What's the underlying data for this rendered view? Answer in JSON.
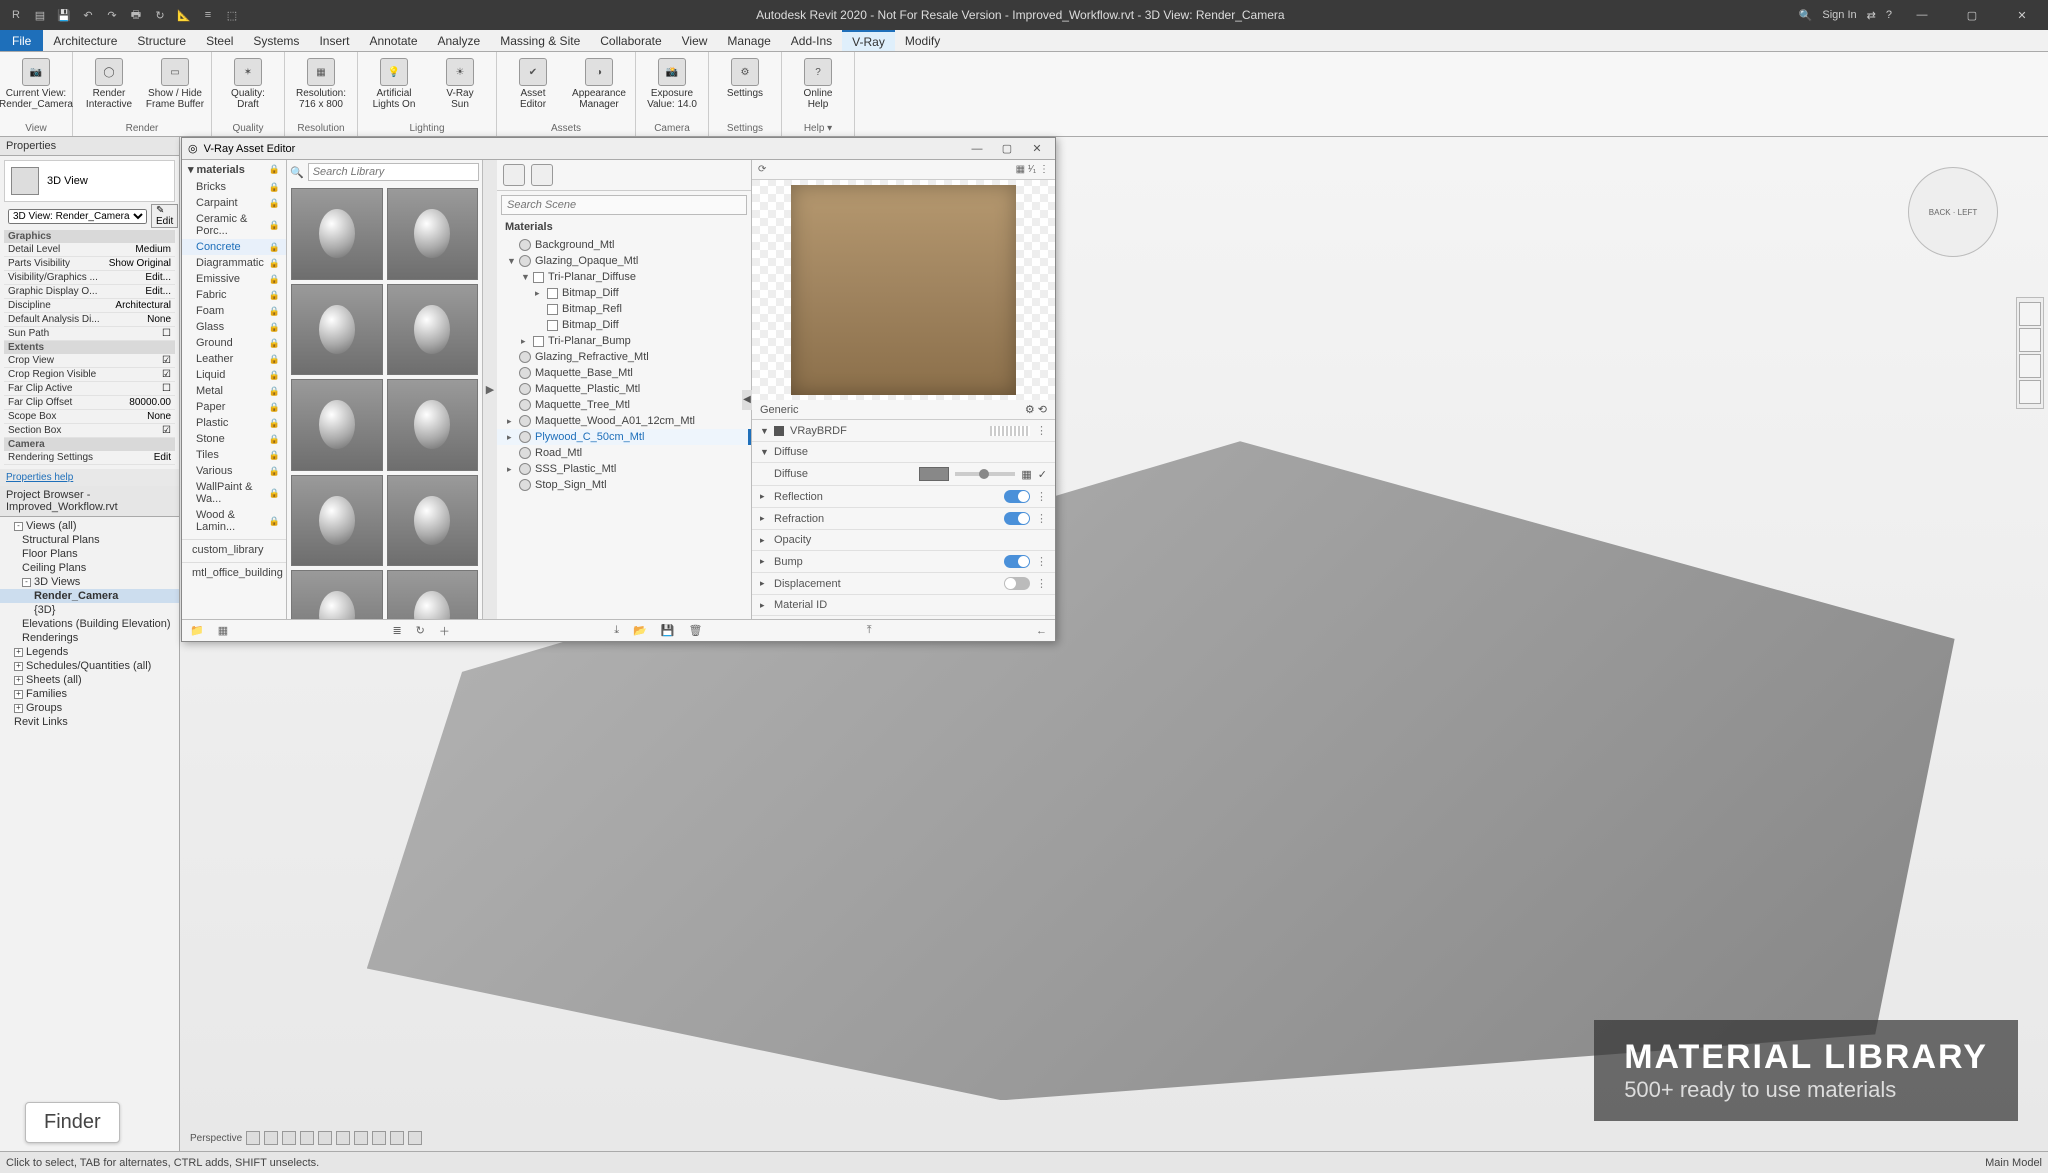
{
  "titlebar": {
    "title": "Autodesk Revit 2020 - Not For Resale Version - Improved_Workflow.rvt - 3D View: Render_Camera",
    "signin": "Sign In"
  },
  "menutabs": [
    "Architecture",
    "Structure",
    "Steel",
    "Systems",
    "Insert",
    "Annotate",
    "Analyze",
    "Massing & Site",
    "Collaborate",
    "View",
    "Manage",
    "Add-Ins",
    "V-Ray",
    "Modify"
  ],
  "active_tab": "V-Ray",
  "file_tab": "File",
  "ribbon": {
    "groups": [
      {
        "name": "View",
        "btns": [
          {
            "label": "Current View:\nRender_Camera",
            "icon": "📷"
          }
        ]
      },
      {
        "name": "Render",
        "btns": [
          {
            "label": "Render\nInteractive",
            "icon": "◯"
          },
          {
            "label": "Show / Hide\nFrame Buffer",
            "icon": "▭"
          }
        ]
      },
      {
        "name": "Quality",
        "btns": [
          {
            "label": "Quality:\nDraft",
            "icon": "✶"
          }
        ]
      },
      {
        "name": "Resolution",
        "btns": [
          {
            "label": "Resolution:\n716 x 800",
            "icon": "▦"
          }
        ]
      },
      {
        "name": "Lighting",
        "btns": [
          {
            "label": "Artificial\nLights On",
            "icon": "💡"
          },
          {
            "label": "V-Ray\nSun",
            "icon": "☀"
          }
        ]
      },
      {
        "name": "Assets",
        "btns": [
          {
            "label": "Asset\nEditor",
            "icon": "✔"
          },
          {
            "label": "Appearance\nManager",
            "icon": "◑"
          }
        ]
      },
      {
        "name": "Camera",
        "btns": [
          {
            "label": "Exposure\nValue: 14.0",
            "icon": "📸"
          }
        ]
      },
      {
        "name": "Settings",
        "btns": [
          {
            "label": "Settings",
            "icon": "⚙"
          }
        ]
      },
      {
        "name": "Help ▾",
        "btns": [
          {
            "label": "Online\nHelp",
            "icon": "?"
          }
        ]
      }
    ]
  },
  "properties": {
    "panel_title": "Properties",
    "view_type": "3D View",
    "type_selector": "3D View: Render_Camera",
    "edit_btn": "Edit",
    "graphics_hdr": "Graphics",
    "extents_hdr": "Extents",
    "camera_hdr": "Camera",
    "rows": [
      {
        "k": "Detail Level",
        "v": "Medium"
      },
      {
        "k": "Parts Visibility",
        "v": "Show Original"
      },
      {
        "k": "Visibility/Graphics ...",
        "v": "Edit..."
      },
      {
        "k": "Graphic Display O...",
        "v": "Edit..."
      },
      {
        "k": "Discipline",
        "v": "Architectural"
      },
      {
        "k": "Default Analysis Di...",
        "v": "None"
      },
      {
        "k": "Sun Path",
        "v": "☐"
      }
    ],
    "extents_rows": [
      {
        "k": "Crop View",
        "v": "☑"
      },
      {
        "k": "Crop Region Visible",
        "v": "☑"
      },
      {
        "k": "Far Clip Active",
        "v": "☐"
      },
      {
        "k": "Far Clip Offset",
        "v": "80000.00"
      },
      {
        "k": "Scope Box",
        "v": "None"
      },
      {
        "k": "Section Box",
        "v": "☑"
      }
    ],
    "camera_rows": [
      {
        "k": "Rendering Settings",
        "v": "Edit"
      }
    ],
    "help_link": "Properties help"
  },
  "browser": {
    "title": "Project Browser - Improved_Workflow.rvt",
    "items": [
      {
        "l": 0,
        "exp": "-",
        "t": "Views (all)"
      },
      {
        "l": 1,
        "exp": "",
        "t": "Structural Plans"
      },
      {
        "l": 1,
        "exp": "",
        "t": "Floor Plans"
      },
      {
        "l": 1,
        "exp": "",
        "t": "Ceiling Plans"
      },
      {
        "l": 1,
        "exp": "-",
        "t": "3D Views"
      },
      {
        "l": 2,
        "exp": "",
        "t": "Render_Camera",
        "sel": true
      },
      {
        "l": 2,
        "exp": "",
        "t": "{3D}"
      },
      {
        "l": 1,
        "exp": "",
        "t": "Elevations (Building Elevation)"
      },
      {
        "l": 1,
        "exp": "",
        "t": "Renderings"
      },
      {
        "l": 0,
        "exp": "+",
        "t": "Legends"
      },
      {
        "l": 0,
        "exp": "+",
        "t": "Schedules/Quantities (all)"
      },
      {
        "l": 0,
        "exp": "+",
        "t": "Sheets (all)"
      },
      {
        "l": 0,
        "exp": "+",
        "t": "Families"
      },
      {
        "l": 0,
        "exp": "+",
        "t": "Groups"
      },
      {
        "l": 0,
        "exp": "",
        "t": "Revit Links"
      }
    ]
  },
  "asset_editor": {
    "title": "V-Ray Asset Editor",
    "search_library": "Search Library",
    "search_scene": "Search Scene",
    "lib_header": "materials",
    "categories": [
      "Bricks",
      "Carpaint",
      "Ceramic & Porc...",
      "Concrete",
      "Diagrammatic",
      "Emissive",
      "Fabric",
      "Foam",
      "Glass",
      "Ground",
      "Leather",
      "Liquid",
      "Metal",
      "Paper",
      "Plastic",
      "Stone",
      "Tiles",
      "Various",
      "WallPaint & Wa...",
      "Wood & Lamin..."
    ],
    "active_cat": "Concrete",
    "extra_cats": [
      "custom_library",
      "mtl_office_building"
    ],
    "materials_hdr": "Materials",
    "materials": [
      {
        "d": 0,
        "t": "Background_Mtl",
        "exp": ""
      },
      {
        "d": 0,
        "t": "Glazing_Opaque_Mtl",
        "exp": "▼"
      },
      {
        "d": 1,
        "t": "Tri-Planar_Diffuse",
        "exp": "▼",
        "box": true
      },
      {
        "d": 2,
        "t": "Bitmap_Diff",
        "exp": "▸",
        "box": true
      },
      {
        "d": 2,
        "t": "Bitmap_Refl",
        "exp": "",
        "box": true
      },
      {
        "d": 2,
        "t": "Bitmap_Diff",
        "exp": "",
        "box": true
      },
      {
        "d": 1,
        "t": "Tri-Planar_Bump",
        "exp": "▸",
        "box": true
      },
      {
        "d": 0,
        "t": "Glazing_Refractive_Mtl",
        "exp": ""
      },
      {
        "d": 0,
        "t": "Maquette_Base_Mtl",
        "exp": ""
      },
      {
        "d": 0,
        "t": "Maquette_Plastic_Mtl",
        "exp": ""
      },
      {
        "d": 0,
        "t": "Maquette_Tree_Mtl",
        "exp": ""
      },
      {
        "d": 0,
        "t": "Maquette_Wood_A01_12cm_Mtl",
        "exp": "▸"
      },
      {
        "d": 0,
        "t": "Plywood_C_50cm_Mtl",
        "exp": "▸",
        "sel": true
      },
      {
        "d": 0,
        "t": "Road_Mtl",
        "exp": ""
      },
      {
        "d": 0,
        "t": "SSS_Plastic_Mtl",
        "exp": "▸"
      },
      {
        "d": 0,
        "t": "Stop_Sign_Mtl",
        "exp": ""
      }
    ],
    "props": {
      "generic": "Generic",
      "brdf": "VRayBRDF",
      "rows": [
        {
          "label": "Diffuse",
          "exp": "▼",
          "control": "header"
        },
        {
          "label": "Diffuse",
          "control": "swatch-slider"
        },
        {
          "label": "Reflection",
          "exp": "▸",
          "control": "toggle-on"
        },
        {
          "label": "Refraction",
          "exp": "▸",
          "control": "toggle-on"
        },
        {
          "label": "Opacity",
          "exp": "▸",
          "control": "none"
        },
        {
          "label": "Bump",
          "exp": "▸",
          "control": "toggle-half"
        },
        {
          "label": "Displacement",
          "exp": "▸",
          "control": "toggle-off"
        },
        {
          "label": "Material ID",
          "exp": "▸",
          "control": "none"
        }
      ]
    }
  },
  "overlay": {
    "title": "MATERIAL LIBRARY",
    "subtitle": "500+ ready to use materials"
  },
  "finder": "Finder",
  "status": {
    "hint": "Click to select, TAB for alternates, CTRL adds, SHIFT unselects.",
    "model": "Main Model"
  },
  "viewport": {
    "label": "Perspective"
  }
}
